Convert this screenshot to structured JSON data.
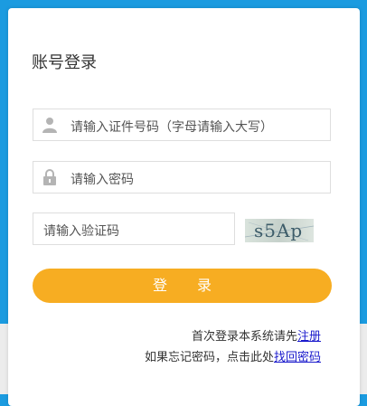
{
  "login": {
    "title": "账号登录",
    "id_placeholder": "请输入证件号码（字母请输入大写）",
    "password_placeholder": "请输入密码",
    "captcha_placeholder": "请输入验证码",
    "captcha_text": "s5Ap",
    "login_button": "登 录",
    "first_login_text": "首次登录本系统请先",
    "register_link": "注册",
    "forgot_text": "如果忘记密码，点击此处",
    "recover_link": "找回密码"
  },
  "icons": {
    "user": "user-icon",
    "lock": "lock-icon"
  },
  "colors": {
    "background": "#1b9be0",
    "button": "#f7ad22",
    "link": "#1a1acc"
  }
}
